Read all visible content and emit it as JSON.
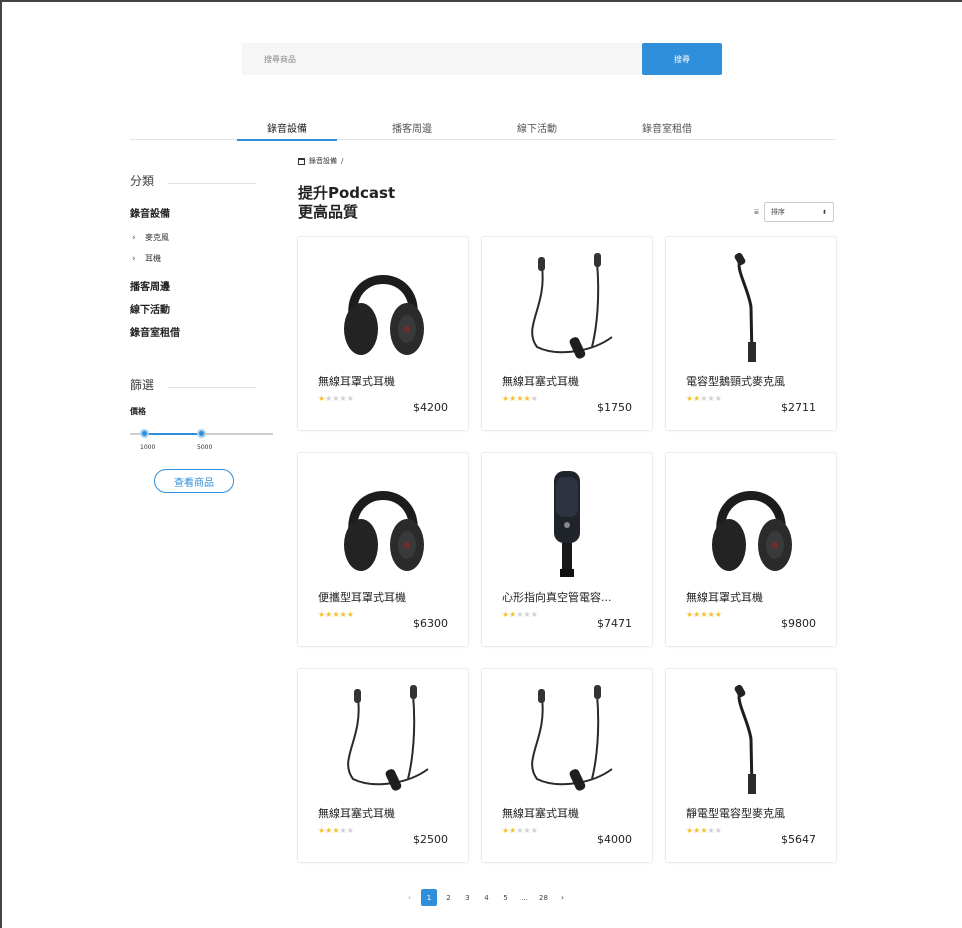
{
  "search": {
    "placeholder": "搜尋商品",
    "button_label": "搜尋"
  },
  "tabs": [
    {
      "label": "錄音設備",
      "active": true
    },
    {
      "label": "播客周邊",
      "active": false
    },
    {
      "label": "線下活動",
      "active": false
    },
    {
      "label": "錄音室租借",
      "active": false
    }
  ],
  "sidebar": {
    "category_title": "分類",
    "categories": [
      {
        "label": "錄音設備",
        "subs": [
          "麥克風",
          "耳機"
        ]
      },
      {
        "label": "播客周邊"
      },
      {
        "label": "線下活動"
      },
      {
        "label": "錄音室租借"
      }
    ],
    "filter_title": "篩選",
    "price_label": "價格",
    "price_min": "1000",
    "price_max": "5000",
    "view_button": "查看商品"
  },
  "breadcrumb": {
    "current": "錄音設備",
    "separator": "/"
  },
  "heading": {
    "line1": "提升Podcast",
    "line2": "更高品質"
  },
  "sort": {
    "label": "排序"
  },
  "products": [
    {
      "name": "無線耳罩式耳機",
      "price": "$4200",
      "rating": 1,
      "icon": "headphones-icon"
    },
    {
      "name": "無線耳塞式耳機",
      "price": "$1750",
      "rating": 4,
      "icon": "earbuds-icon"
    },
    {
      "name": "電容型鵝頸式麥克風",
      "price": "$2711",
      "rating": 2,
      "icon": "gooseneck-mic-icon"
    },
    {
      "name": "便攜型耳罩式耳機",
      "price": "$6300",
      "rating": 5,
      "icon": "headphones-icon"
    },
    {
      "name": "心形指向真空管電容...",
      "price": "$7471",
      "rating": 2,
      "icon": "studio-mic-icon"
    },
    {
      "name": "無線耳罩式耳機",
      "price": "$9800",
      "rating": 5,
      "icon": "headphones-icon"
    },
    {
      "name": "無線耳塞式耳機",
      "price": "$2500",
      "rating": 3,
      "icon": "earbuds-icon"
    },
    {
      "name": "無線耳塞式耳機",
      "price": "$4000",
      "rating": 2,
      "icon": "earbuds-icon"
    },
    {
      "name": "靜電型電容型麥克風",
      "price": "$5647",
      "rating": 3,
      "icon": "gooseneck-mic-icon"
    }
  ],
  "pagination": {
    "prev": "‹",
    "pages": [
      "1",
      "2",
      "3",
      "4",
      "5",
      "…",
      "28"
    ],
    "current": "1",
    "next": "›"
  },
  "colors": {
    "accent": "#2f8fdb",
    "star": "#f2c12e"
  }
}
